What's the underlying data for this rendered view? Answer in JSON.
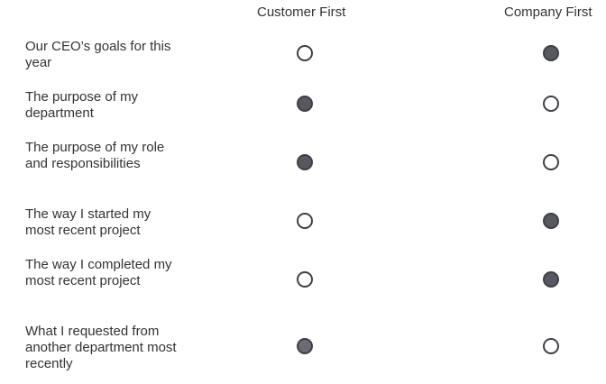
{
  "columns": [
    "Customer First",
    "Company First"
  ],
  "rows": [
    {
      "label": "Our CEO’s goals for this year",
      "selected": 1
    },
    {
      "label": "The purpose of my department",
      "selected": 0
    },
    {
      "label": "The purpose of my role and responsibilities",
      "selected": 0
    },
    {
      "label": "The way I started my most recent project",
      "selected": 1
    },
    {
      "label": "The way I completed my most recent project",
      "selected": 1
    },
    {
      "label": "What I requested from another department most recently",
      "selected": 0
    }
  ]
}
